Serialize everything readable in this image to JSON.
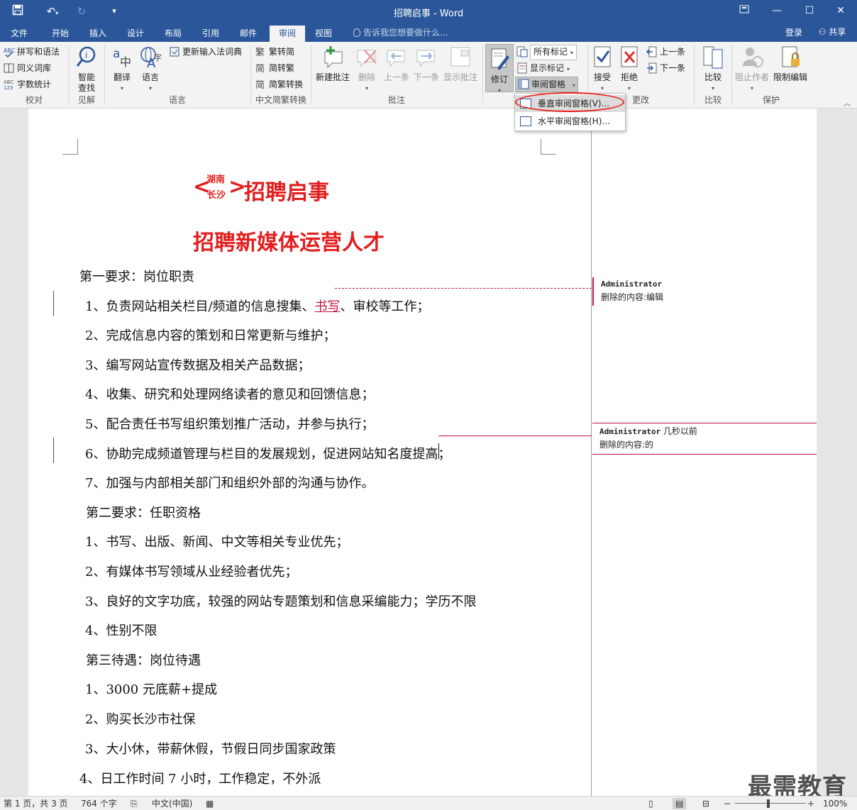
{
  "window": {
    "title": "招聘启事 - Word"
  },
  "tabs": [
    "文件",
    "开始",
    "插入",
    "设计",
    "布局",
    "引用",
    "邮件",
    "审阅",
    "视图"
  ],
  "active_tab": "审阅",
  "tell_me": "告诉我您想要做什么...",
  "account": {
    "login": "登录",
    "share": "共享"
  },
  "ribbon": {
    "proofing": {
      "items": [
        "拼写和语法",
        "同义词库",
        "字数统计"
      ],
      "group": "校对"
    },
    "insights": {
      "label": "智能查找",
      "group": "见解"
    },
    "language": {
      "translate": "翻译",
      "language": "语言",
      "ime": "更新输入法词典",
      "group": "语言"
    },
    "chinese": {
      "items": [
        "繁转简",
        "简转繁",
        "简繁转换"
      ],
      "group": "中文简繁转换"
    },
    "comments": {
      "new": "新建批注",
      "delete": "删除",
      "prev": "上一条",
      "next": "下一条",
      "show": "显示批注",
      "group": "批注"
    },
    "tracking": {
      "track": "修订",
      "markup": "所有标记",
      "show_markup": "显示标记",
      "pane": "审阅窗格",
      "group": "修订"
    },
    "changes": {
      "accept": "接受",
      "reject": "拒绝",
      "prev": "上一条",
      "next": "下一条",
      "group": "更改"
    },
    "compare": {
      "label": "比较",
      "group": "比较"
    },
    "protect": {
      "block": "阻止作者",
      "restrict": "限制编辑",
      "group": "保护"
    }
  },
  "dropdown": {
    "vertical": "垂直审阅窗格(V)...",
    "horizontal": "水平审阅窗格(H)..."
  },
  "document": {
    "title_small_top": "湖南",
    "title_small_bottom": "长沙",
    "title_main": "招聘启事",
    "subtitle": "招聘新媒体运营人才",
    "lines": [
      "第一要求：岗位职责",
      "1、负责网站相关栏目/频道的信息搜集、",
      "书写",
      "、审校等工作；",
      "2、完成信息内容的策划和日常更新与维护；",
      "3、编写网站宣传数据及相关产品数据；",
      "4、收集、研究和处理网络读者的意见和回馈信息；",
      "5、配合责任书写组织策划推广活动，并参与执行；",
      "6、协助完成频道管理与栏目的发展规划，促进网站知名度提高；",
      "7、加强与内部相关部门和组织外部的沟通与协作。",
      "第二要求：任职资格",
      "1、书写、出版、新闻、中文等相关专业优先；",
      "2、有媒体书写领域从业经验者优先；",
      "3、良好的文字功底，较强的网站专题策划和信息采编能力；学历不限",
      "4、性别不限",
      "第三待遇：岗位待遇",
      "1、3000 元底薪+提成",
      "2、购买长沙市社保",
      "3、大小休，带薪休假，节假日同步国家政策",
      "4、日工作时间 7 小时，工作稳定，不外派"
    ]
  },
  "comments": [
    {
      "author": "Administrator",
      "time": "",
      "text": "删除的内容:编辑"
    },
    {
      "author": "Administrator",
      "time": "几秒以前",
      "text": "删除的内容:的"
    }
  ],
  "status": {
    "page": "第 1 页，共 3 页",
    "words": "764 个字",
    "lang": "中文(中国)",
    "zoom": "100%"
  },
  "watermark": "最需教育",
  "colors": {
    "accent": "#2b579a",
    "revision": "#c0143c",
    "highlight_oval": "#e8201d"
  }
}
